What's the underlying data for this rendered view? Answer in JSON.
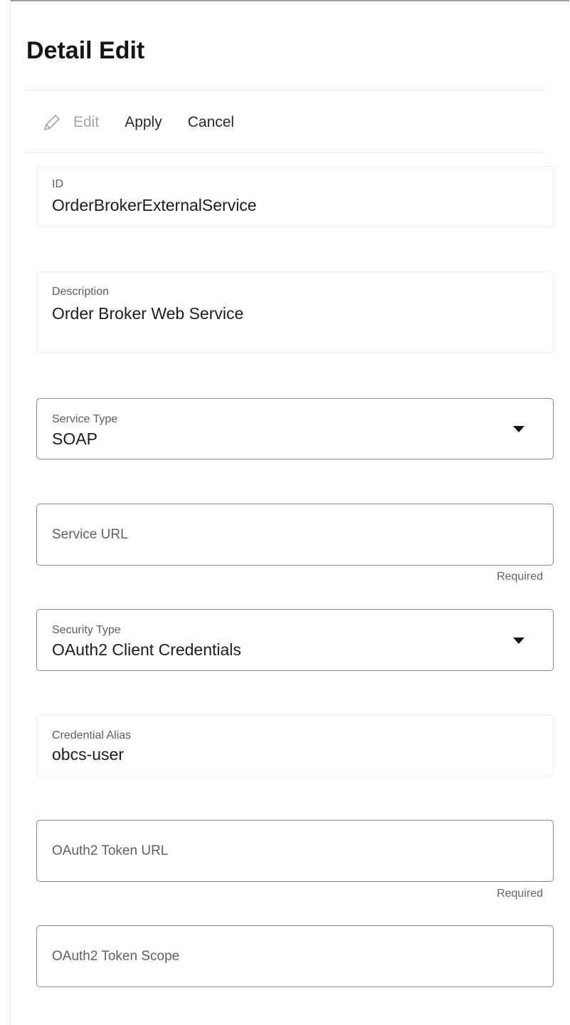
{
  "header": {
    "title": "Detail Edit"
  },
  "toolbar": {
    "edit_label": "Edit",
    "apply_label": "Apply",
    "cancel_label": "Cancel"
  },
  "fields": {
    "id": {
      "label": "ID",
      "value": "OrderBrokerExternalService"
    },
    "description": {
      "label": "Description",
      "value": "Order Broker Web Service"
    },
    "service_type": {
      "label": "Service Type",
      "value": "SOAP"
    },
    "service_url": {
      "placeholder": "Service URL",
      "hint": "Required"
    },
    "security_type": {
      "label": "Security Type",
      "value": "OAuth2 Client Credentials"
    },
    "credential_alias": {
      "label": "Credential Alias",
      "value": "obcs-user"
    },
    "oauth2_token_url": {
      "placeholder": "OAuth2 Token URL",
      "hint": "Required"
    },
    "oauth2_token_scope": {
      "placeholder": "OAuth2 Token Scope"
    }
  },
  "icons": {
    "edit": "pencil-icon",
    "dropdown": "caret-down-icon"
  },
  "colors": {
    "text": "#1d1d1d",
    "label": "#5e5e5e",
    "disabled": "#a5a5a5",
    "editable_border": "#8b8b8b",
    "readonly_border": "#ececec"
  }
}
